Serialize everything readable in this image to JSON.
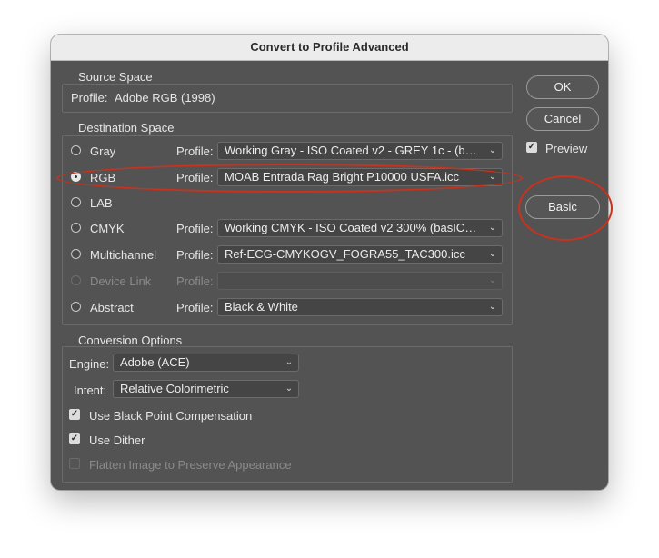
{
  "window": {
    "title": "Convert to Profile Advanced"
  },
  "source_space": {
    "title": "Source Space",
    "profile_label": "Profile:",
    "profile_value": "Adobe RGB (1998)"
  },
  "destination_space": {
    "title": "Destination Space",
    "profile_label": "Profile:",
    "rows": [
      {
        "label": "Gray",
        "profile": "Working Gray - ISO Coated v2 - GREY 1c - (basICC...",
        "checked": false,
        "disabled": false
      },
      {
        "label": "RGB",
        "profile": "MOAB Entrada Rag Bright P10000 USFA.icc",
        "checked": true,
        "disabled": false
      },
      {
        "label": "LAB",
        "profile": "",
        "checked": false,
        "disabled": false
      },
      {
        "label": "CMYK",
        "profile": "Working CMYK - ISO Coated v2 300% (basICColor)",
        "checked": false,
        "disabled": false
      },
      {
        "label": "Multichannel",
        "profile": "Ref-ECG-CMYKOGV_FOGRA55_TAC300.icc",
        "checked": false,
        "disabled": false
      },
      {
        "label": "Device Link",
        "profile": "",
        "checked": false,
        "disabled": true
      },
      {
        "label": "Abstract",
        "profile": "Black & White",
        "checked": false,
        "disabled": false
      }
    ]
  },
  "conversion_options": {
    "title": "Conversion Options",
    "engine_label": "Engine:",
    "engine_value": "Adobe (ACE)",
    "intent_label": "Intent:",
    "intent_value": "Relative Colorimetric",
    "black_point_label": "Use Black Point Compensation",
    "black_point_checked": true,
    "dither_label": "Use Dither",
    "dither_checked": true,
    "flatten_label": "Flatten Image to Preserve Appearance",
    "flatten_checked": false
  },
  "buttons": {
    "ok": "OK",
    "cancel": "Cancel",
    "preview_label": "Preview",
    "preview_checked": true,
    "basic": "Basic"
  },
  "colors": {
    "dialog_bg": "#535353",
    "annotation": "#c8321e"
  },
  "icons": {
    "dropdown": "chevron-down-icon",
    "check": "checkmark-icon"
  }
}
